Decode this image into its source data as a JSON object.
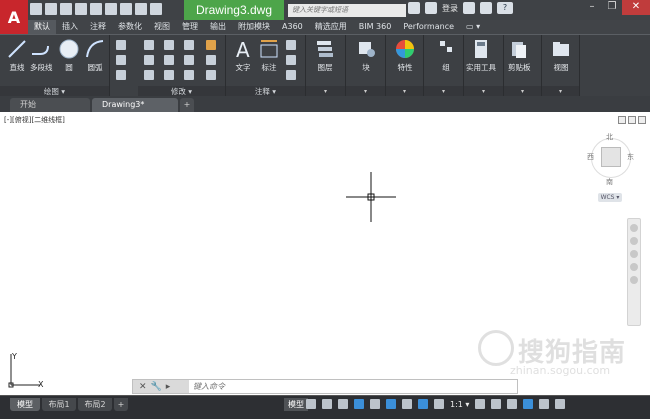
{
  "app": {
    "logo_letter": "A",
    "title": "Drawing3.dwg",
    "search_placeholder": "键入关键字或短语",
    "login_label": "登录",
    "help_label": "?"
  },
  "ribbon_tabs": [
    {
      "label": "默认",
      "active": true
    },
    {
      "label": "插入"
    },
    {
      "label": "注释"
    },
    {
      "label": "参数化"
    },
    {
      "label": "视图"
    },
    {
      "label": "管理"
    },
    {
      "label": "输出"
    },
    {
      "label": "附加模块"
    },
    {
      "label": "A360"
    },
    {
      "label": "精选应用"
    },
    {
      "label": "BIM 360"
    },
    {
      "label": "Performance"
    }
  ],
  "panels": {
    "draw": {
      "title": "绘图 ▾",
      "tools": [
        "直线",
        "多段线",
        "圆",
        "圆弧"
      ]
    },
    "modify": {
      "title": "修改 ▾"
    },
    "annotation": {
      "title": "注释 ▾",
      "tools": [
        "文字",
        "标注"
      ]
    },
    "layers": {
      "label": "图层"
    },
    "block": {
      "label": "块"
    },
    "properties": {
      "label": "特性"
    },
    "group": {
      "label": "组"
    },
    "utilities": {
      "label": "实用工具"
    },
    "clipboard": {
      "label": "剪贴板"
    },
    "view": {
      "label": "视图"
    }
  },
  "file_tabs": {
    "start": "开始",
    "drawing": "Drawing3*",
    "add": "+"
  },
  "viewport": {
    "label": "[-][俯视][二维线框]",
    "viewcube": {
      "north": "北",
      "south": "南",
      "east": "东",
      "west": "西",
      "wcs": "WCS ▾"
    }
  },
  "ucs": {
    "x": "X",
    "y": "Y"
  },
  "command": {
    "placeholder": "键入命令"
  },
  "layout_tabs": {
    "model": "模型",
    "layout1": "布局1",
    "layout2": "布局2",
    "add": "+"
  },
  "status": {
    "model": "模型",
    "scale": "1:1 ▾"
  },
  "watermark": {
    "text": "搜狗指南",
    "url": "zhinan.sogou.com"
  },
  "colors": {
    "title_green": "#4da54a",
    "logo_red": "#c8262c",
    "ribbon_bg": "#3d4044",
    "canvas": "#ffffff"
  }
}
